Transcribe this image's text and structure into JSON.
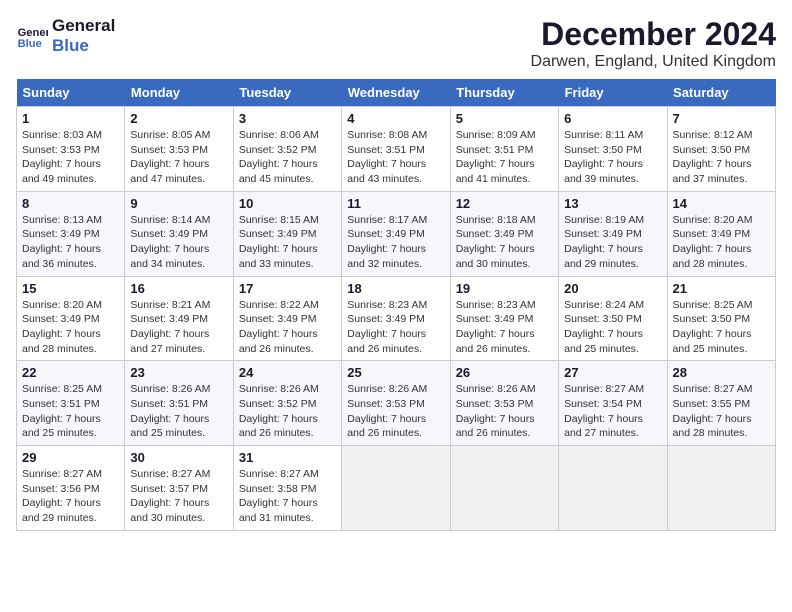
{
  "logo": {
    "line1": "General",
    "line2": "Blue"
  },
  "title": "December 2024",
  "subtitle": "Darwen, England, United Kingdom",
  "header_color": "#3a6abf",
  "days_of_week": [
    "Sunday",
    "Monday",
    "Tuesday",
    "Wednesday",
    "Thursday",
    "Friday",
    "Saturday"
  ],
  "weeks": [
    [
      {
        "num": "1",
        "sunrise": "8:03 AM",
        "sunset": "3:53 PM",
        "daylight": "7 hours and 49 minutes."
      },
      {
        "num": "2",
        "sunrise": "8:05 AM",
        "sunset": "3:53 PM",
        "daylight": "7 hours and 47 minutes."
      },
      {
        "num": "3",
        "sunrise": "8:06 AM",
        "sunset": "3:52 PM",
        "daylight": "7 hours and 45 minutes."
      },
      {
        "num": "4",
        "sunrise": "8:08 AM",
        "sunset": "3:51 PM",
        "daylight": "7 hours and 43 minutes."
      },
      {
        "num": "5",
        "sunrise": "8:09 AM",
        "sunset": "3:51 PM",
        "daylight": "7 hours and 41 minutes."
      },
      {
        "num": "6",
        "sunrise": "8:11 AM",
        "sunset": "3:50 PM",
        "daylight": "7 hours and 39 minutes."
      },
      {
        "num": "7",
        "sunrise": "8:12 AM",
        "sunset": "3:50 PM",
        "daylight": "7 hours and 37 minutes."
      }
    ],
    [
      {
        "num": "8",
        "sunrise": "8:13 AM",
        "sunset": "3:49 PM",
        "daylight": "7 hours and 36 minutes."
      },
      {
        "num": "9",
        "sunrise": "8:14 AM",
        "sunset": "3:49 PM",
        "daylight": "7 hours and 34 minutes."
      },
      {
        "num": "10",
        "sunrise": "8:15 AM",
        "sunset": "3:49 PM",
        "daylight": "7 hours and 33 minutes."
      },
      {
        "num": "11",
        "sunrise": "8:17 AM",
        "sunset": "3:49 PM",
        "daylight": "7 hours and 32 minutes."
      },
      {
        "num": "12",
        "sunrise": "8:18 AM",
        "sunset": "3:49 PM",
        "daylight": "7 hours and 30 minutes."
      },
      {
        "num": "13",
        "sunrise": "8:19 AM",
        "sunset": "3:49 PM",
        "daylight": "7 hours and 29 minutes."
      },
      {
        "num": "14",
        "sunrise": "8:20 AM",
        "sunset": "3:49 PM",
        "daylight": "7 hours and 28 minutes."
      }
    ],
    [
      {
        "num": "15",
        "sunrise": "8:20 AM",
        "sunset": "3:49 PM",
        "daylight": "7 hours and 28 minutes."
      },
      {
        "num": "16",
        "sunrise": "8:21 AM",
        "sunset": "3:49 PM",
        "daylight": "7 hours and 27 minutes."
      },
      {
        "num": "17",
        "sunrise": "8:22 AM",
        "sunset": "3:49 PM",
        "daylight": "7 hours and 26 minutes."
      },
      {
        "num": "18",
        "sunrise": "8:23 AM",
        "sunset": "3:49 PM",
        "daylight": "7 hours and 26 minutes."
      },
      {
        "num": "19",
        "sunrise": "8:23 AM",
        "sunset": "3:49 PM",
        "daylight": "7 hours and 26 minutes."
      },
      {
        "num": "20",
        "sunrise": "8:24 AM",
        "sunset": "3:50 PM",
        "daylight": "7 hours and 25 minutes."
      },
      {
        "num": "21",
        "sunrise": "8:25 AM",
        "sunset": "3:50 PM",
        "daylight": "7 hours and 25 minutes."
      }
    ],
    [
      {
        "num": "22",
        "sunrise": "8:25 AM",
        "sunset": "3:51 PM",
        "daylight": "7 hours and 25 minutes."
      },
      {
        "num": "23",
        "sunrise": "8:26 AM",
        "sunset": "3:51 PM",
        "daylight": "7 hours and 25 minutes."
      },
      {
        "num": "24",
        "sunrise": "8:26 AM",
        "sunset": "3:52 PM",
        "daylight": "7 hours and 26 minutes."
      },
      {
        "num": "25",
        "sunrise": "8:26 AM",
        "sunset": "3:53 PM",
        "daylight": "7 hours and 26 minutes."
      },
      {
        "num": "26",
        "sunrise": "8:26 AM",
        "sunset": "3:53 PM",
        "daylight": "7 hours and 26 minutes."
      },
      {
        "num": "27",
        "sunrise": "8:27 AM",
        "sunset": "3:54 PM",
        "daylight": "7 hours and 27 minutes."
      },
      {
        "num": "28",
        "sunrise": "8:27 AM",
        "sunset": "3:55 PM",
        "daylight": "7 hours and 28 minutes."
      }
    ],
    [
      {
        "num": "29",
        "sunrise": "8:27 AM",
        "sunset": "3:56 PM",
        "daylight": "7 hours and 29 minutes."
      },
      {
        "num": "30",
        "sunrise": "8:27 AM",
        "sunset": "3:57 PM",
        "daylight": "7 hours and 30 minutes."
      },
      {
        "num": "31",
        "sunrise": "8:27 AM",
        "sunset": "3:58 PM",
        "daylight": "7 hours and 31 minutes."
      },
      null,
      null,
      null,
      null
    ]
  ]
}
